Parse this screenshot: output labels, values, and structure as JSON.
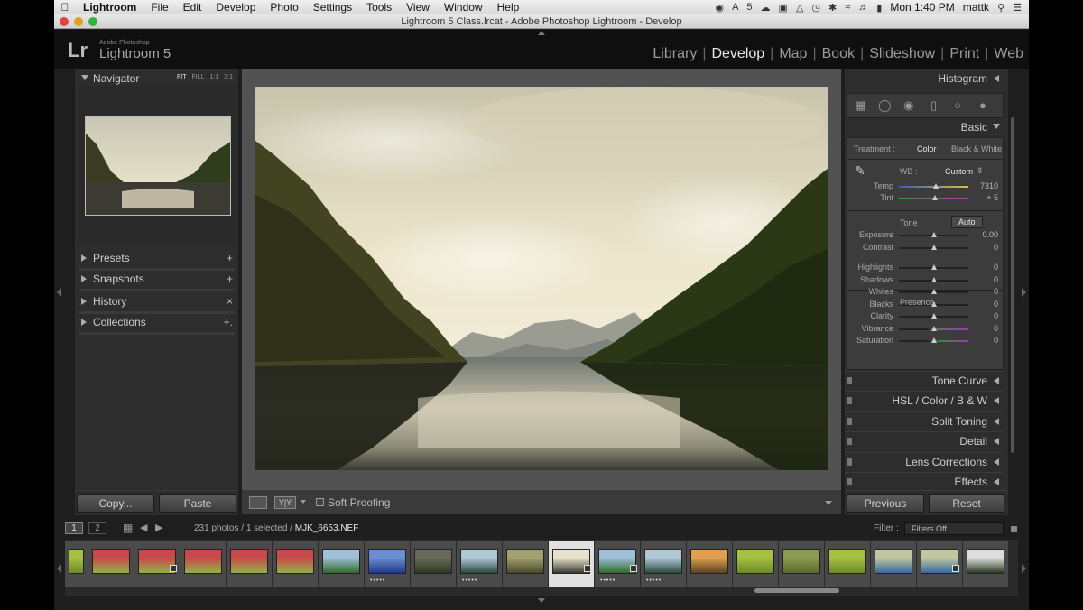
{
  "menubar": {
    "app_name": "Lightroom",
    "items": [
      "File",
      "Edit",
      "Develop",
      "Photo",
      "Settings",
      "Tools",
      "View",
      "Window",
      "Help"
    ],
    "status": {
      "adobe_count": "5",
      "clock": "Mon 1:40 PM",
      "user": "mattk"
    }
  },
  "window": {
    "title": "Lightroom 5 Class.lrcat - Adobe Photoshop Lightroom - Develop"
  },
  "identity": {
    "lr": "Lr",
    "brand_small": "Adobe Photoshop",
    "product": "Lightroom 5"
  },
  "modules": [
    "Library",
    "Develop",
    "Map",
    "Book",
    "Slideshow",
    "Print",
    "Web"
  ],
  "active_module": "Develop",
  "left_panel": {
    "navigator": {
      "title": "Navigator",
      "zoom_options": [
        "FIT",
        "FILL",
        "1:1",
        "3:1"
      ]
    },
    "sections": [
      {
        "label": "Presets",
        "action": "+"
      },
      {
        "label": "Snapshots",
        "action": "+"
      },
      {
        "label": "History",
        "action": "×"
      },
      {
        "label": "Collections",
        "action": "+."
      }
    ],
    "copy_button": "Copy...",
    "paste_button": "Paste"
  },
  "toolbar": {
    "soft_proofing_label": "Soft Proofing",
    "before_after": "Y|Y"
  },
  "right_panel": {
    "histogram": "Histogram",
    "basic_title": "Basic",
    "treatment": {
      "label": "Treatment :",
      "color": "Color",
      "bw": "Black & White"
    },
    "wb": {
      "label": "WB :",
      "value": "Custom"
    },
    "wb_sliders": [
      {
        "name": "Temp",
        "value": "7310",
        "position": 0.53
      },
      {
        "name": "Tint",
        "value": "+ 5",
        "position": 0.52
      }
    ],
    "tone": {
      "title": "Tone",
      "auto": "Auto"
    },
    "tone_sliders": [
      {
        "name": "Exposure",
        "value": "0.00"
      },
      {
        "name": "Contrast",
        "value": "0"
      }
    ],
    "range_sliders": [
      {
        "name": "Highlights",
        "value": "0"
      },
      {
        "name": "Shadows",
        "value": "0"
      },
      {
        "name": "Whites",
        "value": "0"
      },
      {
        "name": "Blacks",
        "value": "0"
      }
    ],
    "presence": {
      "title": "Presence"
    },
    "presence_sliders": [
      {
        "name": "Clarity",
        "value": "0"
      },
      {
        "name": "Vibrance",
        "value": "0"
      },
      {
        "name": "Saturation",
        "value": "0"
      }
    ],
    "collapsed": [
      "Tone Curve",
      "HSL / Color / B & W",
      "Split Toning",
      "Detail",
      "Lens Corrections",
      "Effects"
    ],
    "previous_button": "Previous",
    "reset_button": "Reset"
  },
  "filmstrip_bar": {
    "pages": [
      "1",
      "2"
    ],
    "count_text": "231 photos / 1 selected /",
    "filename": "MJK_6653.NEF",
    "filter_label": "Filter :",
    "filter_value": "Filters Off"
  },
  "filmstrip": {
    "thumbs": [
      {
        "kind": "green",
        "stars": 0
      },
      {
        "kind": "portrait",
        "stars": 0
      },
      {
        "kind": "portrait",
        "stars": 0,
        "badge": true
      },
      {
        "kind": "portrait",
        "stars": 0
      },
      {
        "kind": "portrait",
        "stars": 0
      },
      {
        "kind": "portrait",
        "stars": 0
      },
      {
        "kind": "valley",
        "stars": 0
      },
      {
        "kind": "blue-lake",
        "stars": 5
      },
      {
        "kind": "forest",
        "stars": 0
      },
      {
        "kind": "fjord",
        "stars": 5
      },
      {
        "kind": "mountain",
        "stars": 0
      },
      {
        "kind": "selected",
        "stars": 0,
        "badge": true
      },
      {
        "kind": "valley",
        "stars": 5,
        "badge": true
      },
      {
        "kind": "fjord",
        "stars": 5
      },
      {
        "kind": "sunset",
        "stars": 0
      },
      {
        "kind": "green",
        "stars": 0
      },
      {
        "kind": "field",
        "stars": 0
      },
      {
        "kind": "green",
        "stars": 0
      },
      {
        "kind": "sky",
        "stars": 0
      },
      {
        "kind": "sky",
        "stars": 0,
        "badge": true
      },
      {
        "kind": "waterfall",
        "stars": 0
      }
    ]
  }
}
